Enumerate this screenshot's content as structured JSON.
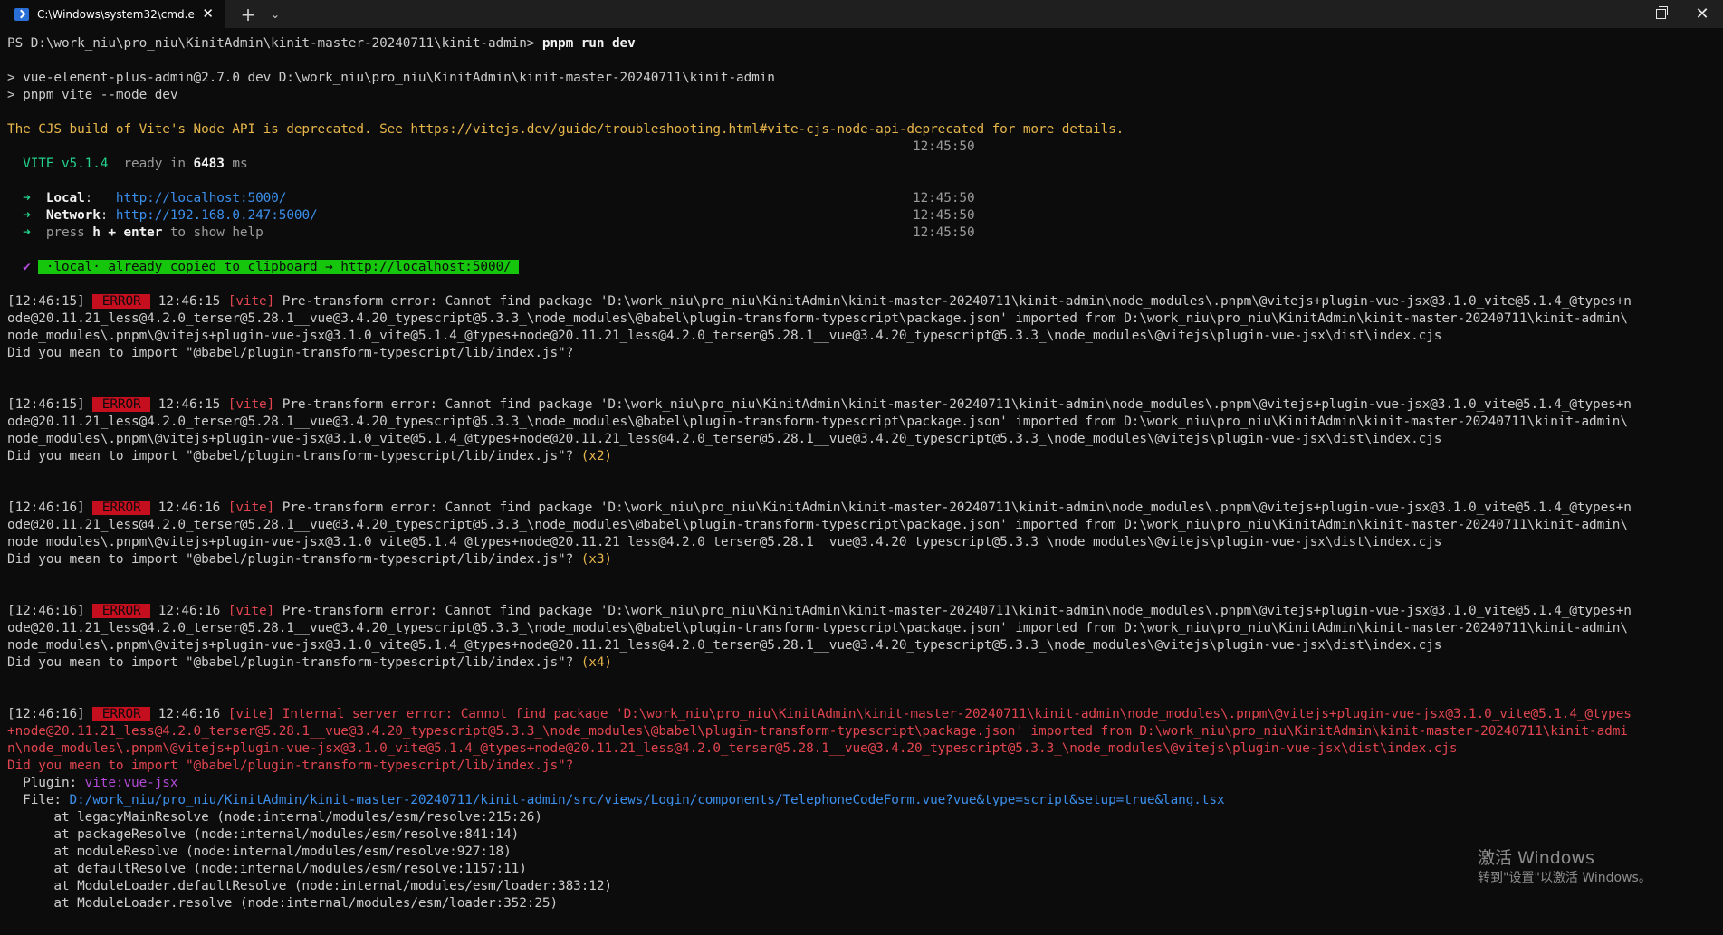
{
  "window": {
    "tab_title": "C:\\Windows\\system32\\cmd.e",
    "tab_close": "✕",
    "new_tab": "+",
    "tab_dropdown": "⌄",
    "close": "✕"
  },
  "terminal": {
    "l1": "PS D:\\work_niu\\pro_niu\\KinitAdmin\\kinit-master-20240711\\kinit-admin> ",
    "l1_cmd": "pnpm run dev",
    "l3": "> vue-element-plus-admin@2.7.0 dev D:\\work_niu\\pro_niu\\KinitAdmin\\kinit-master-20240711\\kinit-admin",
    "l4": "> pnpm vite --mode dev",
    "l6": "The CJS build of Vite's Node API is deprecated. See https://vitejs.dev/guide/troubleshooting.html#vite-cjs-node-api-deprecated for more details.",
    "t7": "12:45:50",
    "vite_name": "  VITE v5.1.4",
    "vite_ready": "  ready in ",
    "vite_ms": "6483",
    "vite_ms_unit": " ms",
    "arrow": "  ➜  ",
    "local_label": "Local",
    "local_colon": ":   ",
    "local_url": "http://localhost:5000/",
    "network_label": "Network",
    "network_colon": ": ",
    "network_url": "http://192.168.0.247:5000/",
    "help_1": "press ",
    "help_h": "h + enter",
    "help_2": " to show help",
    "t10": "12:45:50",
    "t11": "12:45:50",
    "t12": "12:45:50",
    "check": "  ✔ ",
    "copied": " ·local· already copied to clipboard → http://localhost:5000/ ",
    "errors": [
      {
        "ts": "[12:46:15] ",
        "badge": " ERROR ",
        "t": " 12:46:15 ",
        "tag": "[vite]",
        "line1": " Pre-transform error: Cannot find package 'D:\\work_niu\\pro_niu\\KinitAdmin\\kinit-master-20240711\\kinit-admin\\node_modules\\.pnpm\\@vitejs+plugin-vue-jsx@3.1.0_vite@5.1.4_@types+n",
        "line2": "ode@20.11.21_less@4.2.0_terser@5.28.1__vue@3.4.20_typescript@5.3.3_\\node_modules\\@babel\\plugin-transform-typescript\\package.json' imported from D:\\work_niu\\pro_niu\\KinitAdmin\\kinit-master-20240711\\kinit-admin\\",
        "line3": "node_modules\\.pnpm\\@vitejs+plugin-vue-jsx@3.1.0_vite@5.1.4_@types+node@20.11.21_less@4.2.0_terser@5.28.1__vue@3.4.20_typescript@5.3.3_\\node_modules\\@vitejs\\plugin-vue-jsx\\dist\\index.cjs",
        "line4": "Did you mean to import \"@babel/plugin-transform-typescript/lib/index.js\"?",
        "count": ""
      },
      {
        "ts": "[12:46:15] ",
        "badge": " ERROR ",
        "t": " 12:46:15 ",
        "tag": "[vite]",
        "line1": " Pre-transform error: Cannot find package 'D:\\work_niu\\pro_niu\\KinitAdmin\\kinit-master-20240711\\kinit-admin\\node_modules\\.pnpm\\@vitejs+plugin-vue-jsx@3.1.0_vite@5.1.4_@types+n",
        "line2": "ode@20.11.21_less@4.2.0_terser@5.28.1__vue@3.4.20_typescript@5.3.3_\\node_modules\\@babel\\plugin-transform-typescript\\package.json' imported from D:\\work_niu\\pro_niu\\KinitAdmin\\kinit-master-20240711\\kinit-admin\\",
        "line3": "node_modules\\.pnpm\\@vitejs+plugin-vue-jsx@3.1.0_vite@5.1.4_@types+node@20.11.21_less@4.2.0_terser@5.28.1__vue@3.4.20_typescript@5.3.3_\\node_modules\\@vitejs\\plugin-vue-jsx\\dist\\index.cjs",
        "line4": "Did you mean to import \"@babel/plugin-transform-typescript/lib/index.js\"?",
        "count": " (x2)"
      },
      {
        "ts": "[12:46:16] ",
        "badge": " ERROR ",
        "t": " 12:46:16 ",
        "tag": "[vite]",
        "line1": " Pre-transform error: Cannot find package 'D:\\work_niu\\pro_niu\\KinitAdmin\\kinit-master-20240711\\kinit-admin\\node_modules\\.pnpm\\@vitejs+plugin-vue-jsx@3.1.0_vite@5.1.4_@types+n",
        "line2": "ode@20.11.21_less@4.2.0_terser@5.28.1__vue@3.4.20_typescript@5.3.3_\\node_modules\\@babel\\plugin-transform-typescript\\package.json' imported from D:\\work_niu\\pro_niu\\KinitAdmin\\kinit-master-20240711\\kinit-admin\\",
        "line3": "node_modules\\.pnpm\\@vitejs+plugin-vue-jsx@3.1.0_vite@5.1.4_@types+node@20.11.21_less@4.2.0_terser@5.28.1__vue@3.4.20_typescript@5.3.3_\\node_modules\\@vitejs\\plugin-vue-jsx\\dist\\index.cjs",
        "line4": "Did you mean to import \"@babel/plugin-transform-typescript/lib/index.js\"?",
        "count": " (x3)"
      },
      {
        "ts": "[12:46:16] ",
        "badge": " ERROR ",
        "t": " 12:46:16 ",
        "tag": "[vite]",
        "line1": " Pre-transform error: Cannot find package 'D:\\work_niu\\pro_niu\\KinitAdmin\\kinit-master-20240711\\kinit-admin\\node_modules\\.pnpm\\@vitejs+plugin-vue-jsx@3.1.0_vite@5.1.4_@types+n",
        "line2": "ode@20.11.21_less@4.2.0_terser@5.28.1__vue@3.4.20_typescript@5.3.3_\\node_modules\\@babel\\plugin-transform-typescript\\package.json' imported from D:\\work_niu\\pro_niu\\KinitAdmin\\kinit-master-20240711\\kinit-admin\\",
        "line3": "node_modules\\.pnpm\\@vitejs+plugin-vue-jsx@3.1.0_vite@5.1.4_@types+node@20.11.21_less@4.2.0_terser@5.28.1__vue@3.4.20_typescript@5.3.3_\\node_modules\\@vitejs\\plugin-vue-jsx\\dist\\index.cjs",
        "line4": "Did you mean to import \"@babel/plugin-transform-typescript/lib/index.js\"?",
        "count": " (x4)"
      }
    ],
    "internal": {
      "ts": "[12:46:16] ",
      "badge": " ERROR ",
      "t": " 12:46:16 ",
      "tag": "[vite]",
      "line1": " Internal server error: Cannot find package 'D:\\work_niu\\pro_niu\\KinitAdmin\\kinit-master-20240711\\kinit-admin\\node_modules\\.pnpm\\@vitejs+plugin-vue-jsx@3.1.0_vite@5.1.4_@types",
      "line2": "+node@20.11.21_less@4.2.0_terser@5.28.1__vue@3.4.20_typescript@5.3.3_\\node_modules\\@babel\\plugin-transform-typescript\\package.json' imported from D:\\work_niu\\pro_niu\\KinitAdmin\\kinit-master-20240711\\kinit-admi",
      "line3": "n\\node_modules\\.pnpm\\@vitejs+plugin-vue-jsx@3.1.0_vite@5.1.4_@types+node@20.11.21_less@4.2.0_terser@5.28.1__vue@3.4.20_typescript@5.3.3_\\node_modules\\@vitejs\\plugin-vue-jsx\\dist\\index.cjs",
      "line4": "Did you mean to import \"@babel/plugin-transform-typescript/lib/index.js\"?",
      "plugin_label": "  Plugin: ",
      "plugin_value": "vite:vue-jsx",
      "file_label": "  File: ",
      "file_value": "D:/work_niu/pro_niu/KinitAdmin/kinit-master-20240711/kinit-admin/src/views/Login/components/TelephoneCodeForm.vue?vue&type=script&setup=true&lang.tsx",
      "stack": [
        "      at legacyMainResolve (node:internal/modules/esm/resolve:215:26)",
        "      at packageResolve (node:internal/modules/esm/resolve:841:14)",
        "      at moduleResolve (node:internal/modules/esm/resolve:927:18)",
        "      at defaultResolve (node:internal/modules/esm/resolve:1157:11)",
        "      at ModuleLoader.defaultResolve (node:internal/modules/esm/loader:383:12)",
        "      at ModuleLoader.resolve (node:internal/modules/esm/loader:352:25)"
      ]
    }
  },
  "watermark": {
    "line1": "激活 Windows",
    "line2": "转到\"设置\"以激活 Windows。"
  }
}
